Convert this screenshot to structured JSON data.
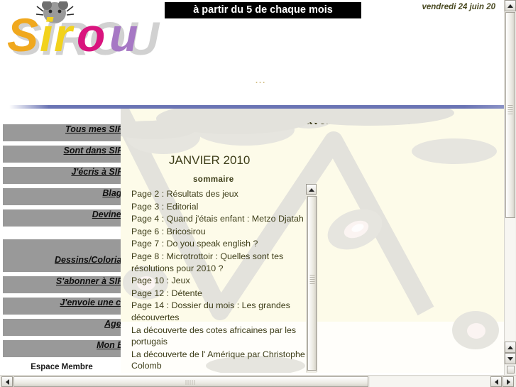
{
  "header": {
    "logo_text": "SIROU",
    "logo_icon": "mouse-head-icon",
    "banner_text": "à partir du 5 de chaque mois",
    "date_text": "vendredi 24 juin 20",
    "mid_dots": "..."
  },
  "sidebar": {
    "items": [
      {
        "label": "Tous mes SIROU"
      },
      {
        "label": "Sont dans SIROU"
      },
      {
        "label": "J'écris à SIROU"
      },
      {
        "label": "Blagues"
      },
      {
        "label": "Devinettes"
      },
      {
        "label": ""
      },
      {
        "label": "Dessins/Coloriages"
      },
      {
        "label": "S'abonner à SIROU"
      },
      {
        "label": "J'envoie une carte"
      },
      {
        "label": "Agenda"
      },
      {
        "label": "Mon Blog"
      }
    ],
    "member_area_label": "Espace Membre"
  },
  "main": {
    "title": "METZO DJATAH \"Travaillez à l'école\"",
    "issue_month": "JANVIER 2010",
    "sommaire_label": "sommaire",
    "sommaire_entries": [
      "Page 2 : Résultats des jeux",
      "Page 3 : Editorial",
      "Page 4 : Quand j'étais enfant : Metzo Djatah",
      "Page 6 : Bricosirou",
      "Page 7 : Do you speak english ?",
      "Page 8 : Microtrottoir : Quelles sont tes résolutions pour 2010 ?",
      "Page 10 : Jeux",
      "Page 12 : Détente",
      "Page 14 : Dossier du mois : Les grandes découvertes",
      "La découverte des cotes africaines par les portugais",
      "La découverte de l' Amérique par Christophe Colomb"
    ]
  },
  "colors": {
    "menu_bar": "#999999",
    "text": "#3d3d18",
    "banner_bg": "#000000",
    "rule": "#6a74b4",
    "content_bg": "#fdfbe9"
  },
  "scrollbars": {
    "inner_up_icon": "triangle-up-icon",
    "vertical_up_icon": "triangle-up-icon",
    "vertical_down_icon": "triangle-down-icon",
    "horizontal_left_icon": "triangle-left-icon",
    "horizontal_right_icon": "triangle-right-icon"
  }
}
